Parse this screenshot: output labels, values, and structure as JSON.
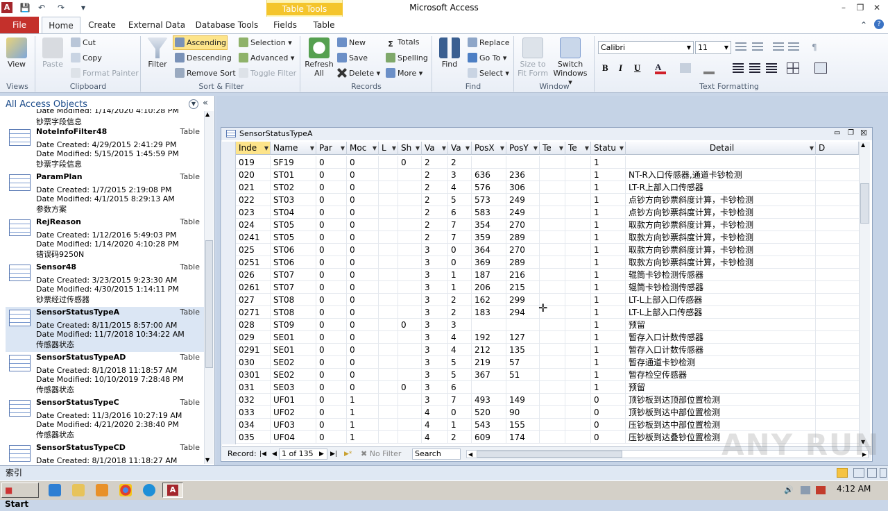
{
  "app": {
    "icon": "A",
    "title": "Microsoft Access",
    "context_group": "Table Tools"
  },
  "tabs": [
    "File",
    "Home",
    "Create",
    "External Data",
    "Database Tools",
    "Fields",
    "Table"
  ],
  "ribbon": {
    "views": {
      "view": "View",
      "group": "Views"
    },
    "clipboard": {
      "paste": "Paste",
      "cut": "Cut",
      "copy": "Copy",
      "format_painter": "Format Painter",
      "group": "Clipboard"
    },
    "sort_filter": {
      "filter": "Filter",
      "ascending": "Ascending",
      "descending": "Descending",
      "remove_sort": "Remove Sort",
      "selection": "Selection",
      "advanced": "Advanced",
      "toggle_filter": "Toggle Filter",
      "group": "Sort & Filter"
    },
    "records": {
      "refresh_line1": "Refresh",
      "refresh_line2": "All",
      "new": "New",
      "save": "Save",
      "delete": "Delete",
      "totals": "Totals",
      "spelling": "Spelling",
      "more": "More",
      "group": "Records"
    },
    "find": {
      "find": "Find",
      "replace": "Replace",
      "goto": "Go To",
      "select": "Select",
      "group": "Find"
    },
    "window": {
      "size_line1": "Size to",
      "size_line2": "Fit Form",
      "switch_line1": "Switch",
      "switch_line2": "Windows",
      "group": "Window"
    },
    "text_formatting": {
      "font": "Calibri",
      "size": "11",
      "group": "Text Formatting",
      "bold": "B",
      "italic": "I",
      "underline": "U"
    }
  },
  "nav": {
    "header": "All Access Objects",
    "top_partial": {
      "modified": "Date Modified: 1/14/2020 4:10:28 PM",
      "desc": "钞票字段信息"
    },
    "items": [
      {
        "name": "NoteInfoFilter48",
        "type": "Table",
        "created": "Date Created: 4/29/2015 2:41:29 PM",
        "modified": "Date Modified: 5/15/2015 1:45:59 PM",
        "desc": "钞票字段信息"
      },
      {
        "name": "ParamPlan",
        "type": "Table",
        "created": "Date Created: 1/7/2015 2:19:08 PM",
        "modified": "Date Modified: 4/1/2015 8:29:13 AM",
        "desc": "参数方案"
      },
      {
        "name": "RejReason",
        "type": "Table",
        "created": "Date Created: 1/12/2016 5:49:03 PM",
        "modified": "Date Modified: 1/14/2020 4:10:28 PM",
        "desc": "错误码9250N"
      },
      {
        "name": "Sensor48",
        "type": "Table",
        "created": "Date Created: 3/23/2015 9:23:30 AM",
        "modified": "Date Modified: 4/30/2015 1:14:11 PM",
        "desc": "钞票经过传感器"
      },
      {
        "name": "SensorStatusTypeA",
        "type": "Table",
        "created": "Date Created: 8/11/2015 8:57:00 AM",
        "modified": "Date Modified: 11/7/2018 10:34:22 AM",
        "desc": "传感器状态"
      },
      {
        "name": "SensorStatusTypeAD",
        "type": "Table",
        "created": "Date Created: 8/1/2018 11:18:57 AM",
        "modified": "Date Modified: 10/10/2019 7:28:48 PM",
        "desc": "传感器状态"
      },
      {
        "name": "SensorStatusTypeC",
        "type": "Table",
        "created": "Date Created: 11/3/2016 10:27:19 AM",
        "modified": "Date Modified: 4/21/2020 2:38:40 PM",
        "desc": "传感器状态"
      },
      {
        "name": "SensorStatusTypeCD",
        "type": "Table",
        "created": "Date Created: 8/1/2018 11:18:27 AM",
        "modified": "",
        "desc": ""
      }
    ]
  },
  "doc": {
    "title": "SensorStatusTypeA",
    "columns": [
      "Inde",
      "Name",
      "Par",
      "Moc",
      "L",
      "Sh",
      "Va",
      "Va",
      "PosX",
      "PosY",
      "Te",
      "Te",
      "Statu",
      "Detail",
      "D"
    ],
    "rows": [
      [
        "019",
        "SF19",
        "0",
        "0",
        "",
        "0",
        "2",
        "2",
        "",
        "",
        "",
        "",
        "1",
        ""
      ],
      [
        "020",
        "ST01",
        "0",
        "0",
        "",
        "",
        "2",
        "3",
        "636",
        "236",
        "",
        "",
        "1",
        "NT-R入口传感器,通道卡钞检测"
      ],
      [
        "021",
        "ST02",
        "0",
        "0",
        "",
        "",
        "2",
        "4",
        "576",
        "306",
        "",
        "",
        "1",
        "LT-R上部入口传感器"
      ],
      [
        "022",
        "ST03",
        "0",
        "0",
        "",
        "",
        "2",
        "5",
        "573",
        "249",
        "",
        "",
        "1",
        "点钞方向钞票斜度计算，卡钞检测"
      ],
      [
        "023",
        "ST04",
        "0",
        "0",
        "",
        "",
        "2",
        "6",
        "583",
        "249",
        "",
        "",
        "1",
        "点钞方向钞票斜度计算，卡钞检测"
      ],
      [
        "024",
        "ST05",
        "0",
        "0",
        "",
        "",
        "2",
        "7",
        "354",
        "270",
        "",
        "",
        "1",
        "取款方向钞票斜度计算，卡钞检测"
      ],
      [
        "0241",
        "ST05",
        "0",
        "0",
        "",
        "",
        "2",
        "7",
        "359",
        "289",
        "",
        "",
        "1",
        "取款方向钞票斜度计算，卡钞检测"
      ],
      [
        "025",
        "ST06",
        "0",
        "0",
        "",
        "",
        "3",
        "0",
        "364",
        "270",
        "",
        "",
        "1",
        "取款方向钞票斜度计算，卡钞检测"
      ],
      [
        "0251",
        "ST06",
        "0",
        "0",
        "",
        "",
        "3",
        "0",
        "369",
        "289",
        "",
        "",
        "1",
        "取款方向钞票斜度计算，卡钞检测"
      ],
      [
        "026",
        "ST07",
        "0",
        "0",
        "",
        "",
        "3",
        "1",
        "187",
        "216",
        "",
        "",
        "1",
        "辊筒卡钞检测传感器"
      ],
      [
        "0261",
        "ST07",
        "0",
        "0",
        "",
        "",
        "3",
        "1",
        "206",
        "215",
        "",
        "",
        "1",
        "辊筒卡钞检测传感器"
      ],
      [
        "027",
        "ST08",
        "0",
        "0",
        "",
        "",
        "3",
        "2",
        "162",
        "299",
        "",
        "",
        "1",
        "LT-L上部入口传感器"
      ],
      [
        "0271",
        "ST08",
        "0",
        "0",
        "",
        "",
        "3",
        "2",
        "183",
        "294",
        "",
        "",
        "1",
        "LT-L上部入口传感器"
      ],
      [
        "028",
        "ST09",
        "0",
        "0",
        "",
        "0",
        "3",
        "3",
        "",
        "",
        "",
        "",
        "1",
        "预留"
      ],
      [
        "029",
        "SE01",
        "0",
        "0",
        "",
        "",
        "3",
        "4",
        "192",
        "127",
        "",
        "",
        "1",
        "暂存入口计数传感器"
      ],
      [
        "0291",
        "SE01",
        "0",
        "0",
        "",
        "",
        "3",
        "4",
        "212",
        "135",
        "",
        "",
        "1",
        "暂存入口计数传感器"
      ],
      [
        "030",
        "SE02",
        "0",
        "0",
        "",
        "",
        "3",
        "5",
        "219",
        "57",
        "",
        "",
        "1",
        "暂存通道卡钞检测"
      ],
      [
        "0301",
        "SE02",
        "0",
        "0",
        "",
        "",
        "3",
        "5",
        "367",
        "51",
        "",
        "",
        "1",
        "暂存检空传感器"
      ],
      [
        "031",
        "SE03",
        "0",
        "0",
        "",
        "0",
        "3",
        "6",
        "",
        "",
        "",
        "",
        "1",
        "预留"
      ],
      [
        "032",
        "UF01",
        "0",
        "1",
        "",
        "",
        "3",
        "7",
        "493",
        "149",
        "",
        "",
        "0",
        "顶钞板到达顶部位置检测"
      ],
      [
        "033",
        "UF02",
        "0",
        "1",
        "",
        "",
        "4",
        "0",
        "520",
        "90",
        "",
        "",
        "0",
        "顶钞板到达中部位置检测"
      ],
      [
        "034",
        "UF03",
        "0",
        "1",
        "",
        "",
        "4",
        "1",
        "543",
        "155",
        "",
        "",
        "0",
        "压钞板到达中部位置检测"
      ],
      [
        "035",
        "UF04",
        "0",
        "1",
        "",
        "",
        "4",
        "2",
        "609",
        "174",
        "",
        "",
        "0",
        "压钞板到达叠钞位置检测"
      ]
    ],
    "record_nav": {
      "label": "Record:",
      "position": "1 of 135",
      "nofilter": "No Filter",
      "search": "Search"
    }
  },
  "status": {
    "text": "索引"
  },
  "taskbar": {
    "start": "Start",
    "clock": "4:12 AM"
  },
  "watermark": "ANY RUN"
}
